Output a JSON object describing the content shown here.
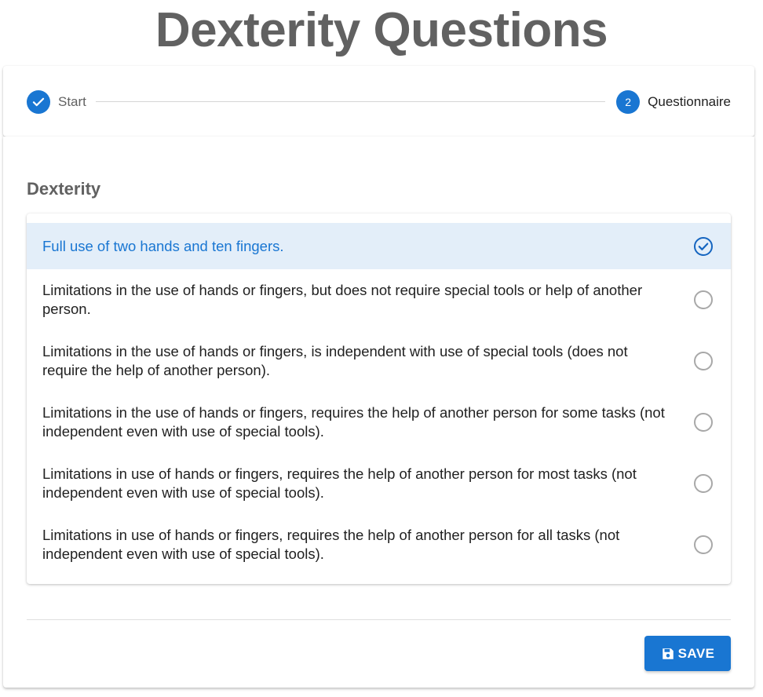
{
  "page": {
    "title": "Dexterity Questions"
  },
  "stepper": {
    "steps": [
      {
        "label": "Start",
        "state": "complete",
        "icon": "check-icon"
      },
      {
        "label": "Questionnaire",
        "number": "2",
        "state": "active"
      }
    ],
    "accent_color": "#1976d2"
  },
  "section": {
    "title": "Dexterity",
    "options": [
      {
        "text": "Full use of two hands and ten fingers.",
        "selected": true
      },
      {
        "text": "Limitations in the use of hands or fingers, but does not require special tools or help of another person.",
        "selected": false
      },
      {
        "text": "Limitations in the use of hands or fingers, is independent with use of special tools (does not require the help of another person).",
        "selected": false
      },
      {
        "text": "Limitations in the use of hands or fingers, requires the help of another person for some tasks (not independent even with use of special tools).",
        "selected": false
      },
      {
        "text": "Limitations in use of hands or fingers, requires the help of another person for most tasks (not independent even with use of special tools).",
        "selected": false
      },
      {
        "text": "Limitations in use of hands or fingers, requires the help of another person for all tasks (not independent even with use of special tools).",
        "selected": false
      }
    ],
    "selected_bg_color": "#e3eef9"
  },
  "actions": {
    "save_label": "SAVE",
    "save_icon": "floppy-disk-icon"
  }
}
